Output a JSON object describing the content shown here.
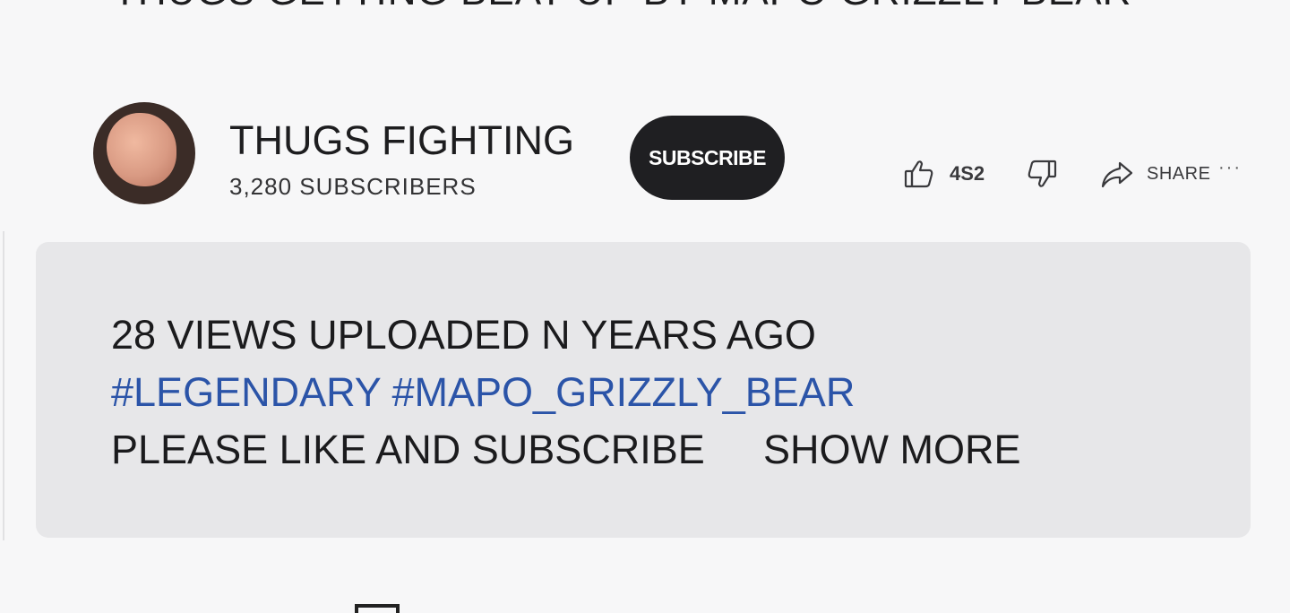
{
  "video": {
    "title": "THUGS GETTING BEAT UP BY MAPO GRIZZLY BEAR"
  },
  "channel": {
    "name": "THUGS FIGHTING",
    "subscribers": "3,280 SUBSCRIBERS",
    "subscribe_label": "SUBSCRIBE"
  },
  "actions": {
    "like_count": "4S2",
    "share_label": "SHARE",
    "more_label": "···"
  },
  "description": {
    "meta": "28 VIEWS UPLOADED N YEARS AGO",
    "hashtags": [
      "#LEGENDARY",
      "#MAPO_GRIZZLY_BEAR"
    ],
    "text": "PLEASE LIKE AND SUBSCRIBE",
    "show_more_label": "SHOW MORE"
  },
  "colors": {
    "background": "#f7f7f8",
    "description_bg": "#e7e7e9",
    "hashtag": "#2b54a8",
    "subscribe_button": "#1f1f22"
  },
  "icons": [
    "thumbs-up-icon",
    "thumbs-down-icon",
    "share-arrow-icon",
    "more-options-icon"
  ]
}
